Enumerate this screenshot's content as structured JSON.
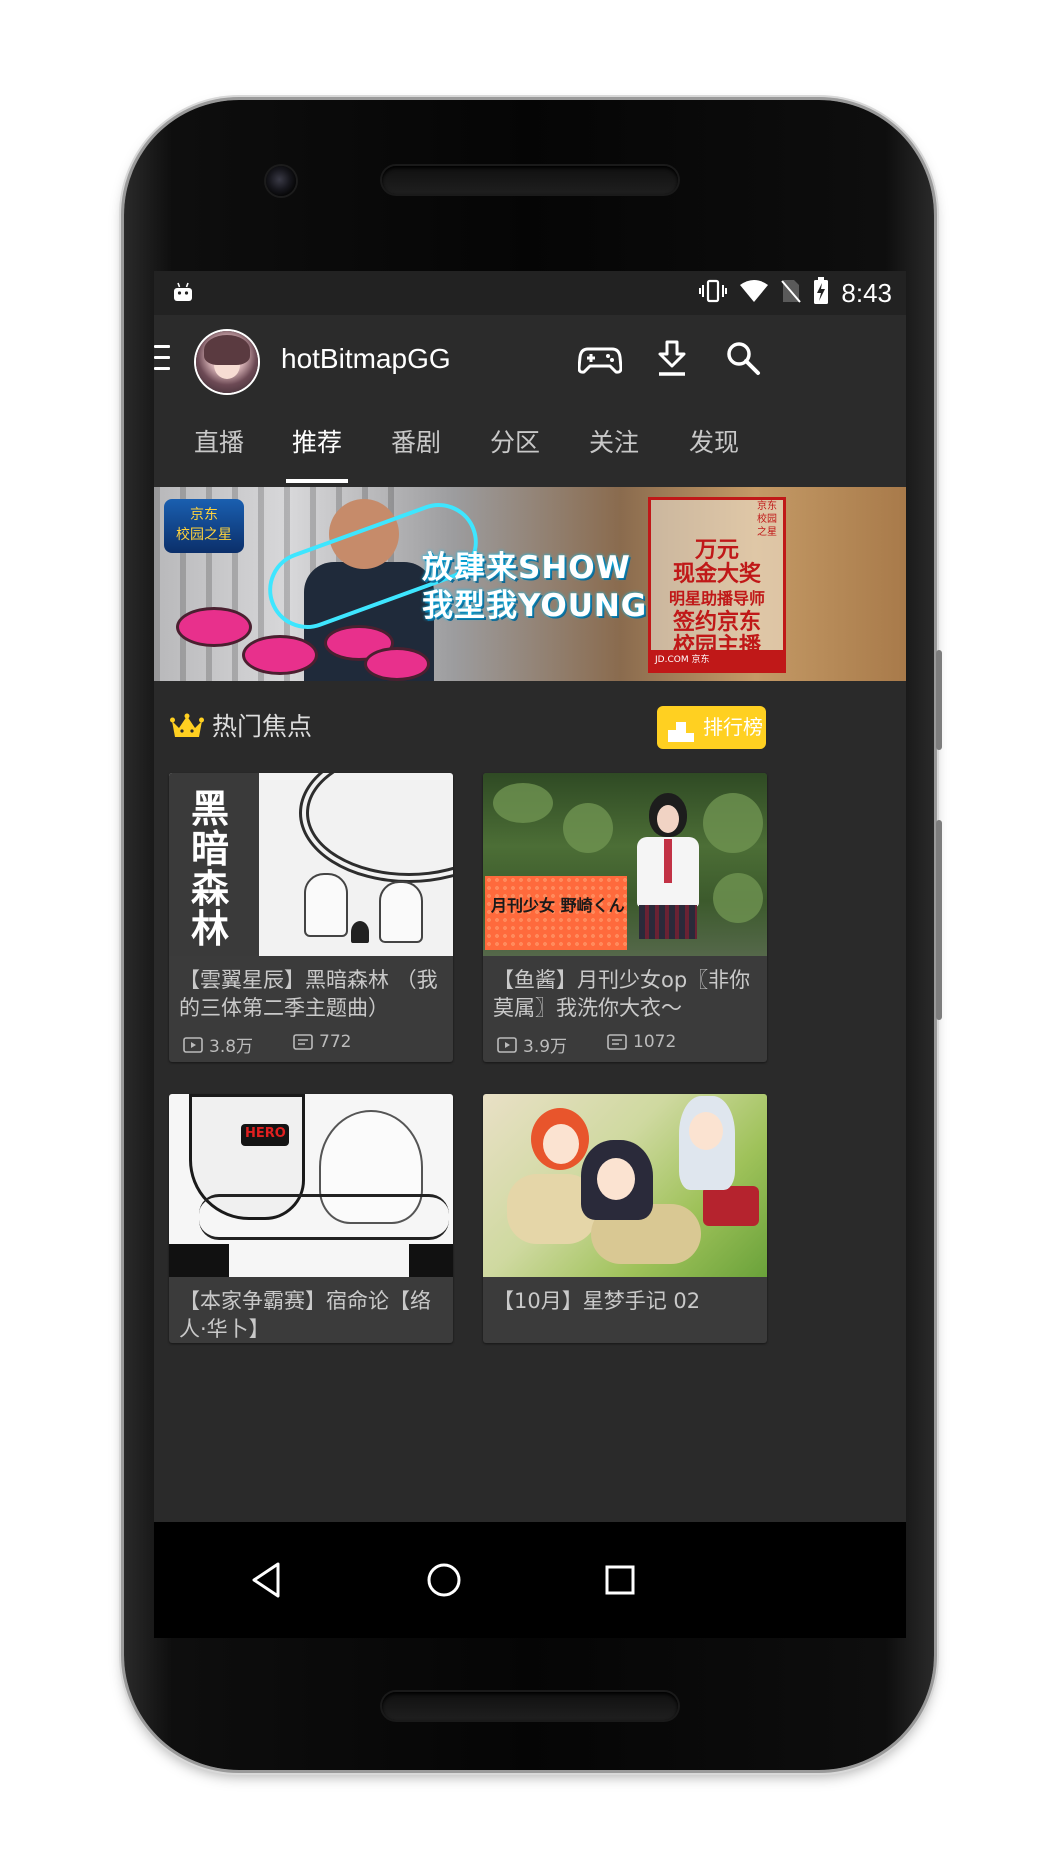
{
  "status_bar": {
    "time": "8:43",
    "icons": [
      "android-icon",
      "vibrate-icon",
      "wifi-icon",
      "no-sim-icon",
      "battery-charging-icon"
    ]
  },
  "toolbar": {
    "username": "hotBitmapGG",
    "icons": [
      "menu-icon",
      "gamepad-icon",
      "download-icon",
      "search-icon"
    ]
  },
  "tabs": [
    {
      "label": "直播",
      "active": false
    },
    {
      "label": "推荐",
      "active": true
    },
    {
      "label": "番剧",
      "active": false
    },
    {
      "label": "分区",
      "active": false
    },
    {
      "label": "关注",
      "active": false
    },
    {
      "label": "发现",
      "active": false
    }
  ],
  "banner": {
    "logo_text": "京东\n校园之星",
    "slogan_line1": "放肆来SHOW",
    "slogan_line2": "我型我YOUNG",
    "board_small": "京东\n校园\n之星",
    "board_lines": [
      "万元",
      "现金大奖",
      "明星助播导师",
      "签约京东",
      "校园主播"
    ],
    "board_footer": "JD.COM 京东"
  },
  "section": {
    "title": "热门焦点",
    "rank_button": "排行榜",
    "accent_color": "#ffd021"
  },
  "videos": [
    {
      "title": "【雲翼星辰】黑暗森林 （我的三体第二季主题曲）",
      "plays": "3.8万",
      "danmaku": "772",
      "thumb_text": "黑暗森林"
    },
    {
      "title": "【鱼酱】月刊少女op〖非你莫属〗我洗你大衣～",
      "plays": "3.9万",
      "danmaku": "1072",
      "thumb_text": "月刊少女 野崎くん"
    },
    {
      "title": "【本家争霸赛】宿命论【络人·华卜】",
      "plays": "",
      "danmaku": "",
      "thumb_text": "HERO"
    },
    {
      "title": "【10月】星梦手记 02",
      "plays": "",
      "danmaku": "",
      "thumb_text": ""
    }
  ],
  "navbar": {
    "icons": [
      "back-icon",
      "home-icon",
      "recents-icon"
    ]
  }
}
